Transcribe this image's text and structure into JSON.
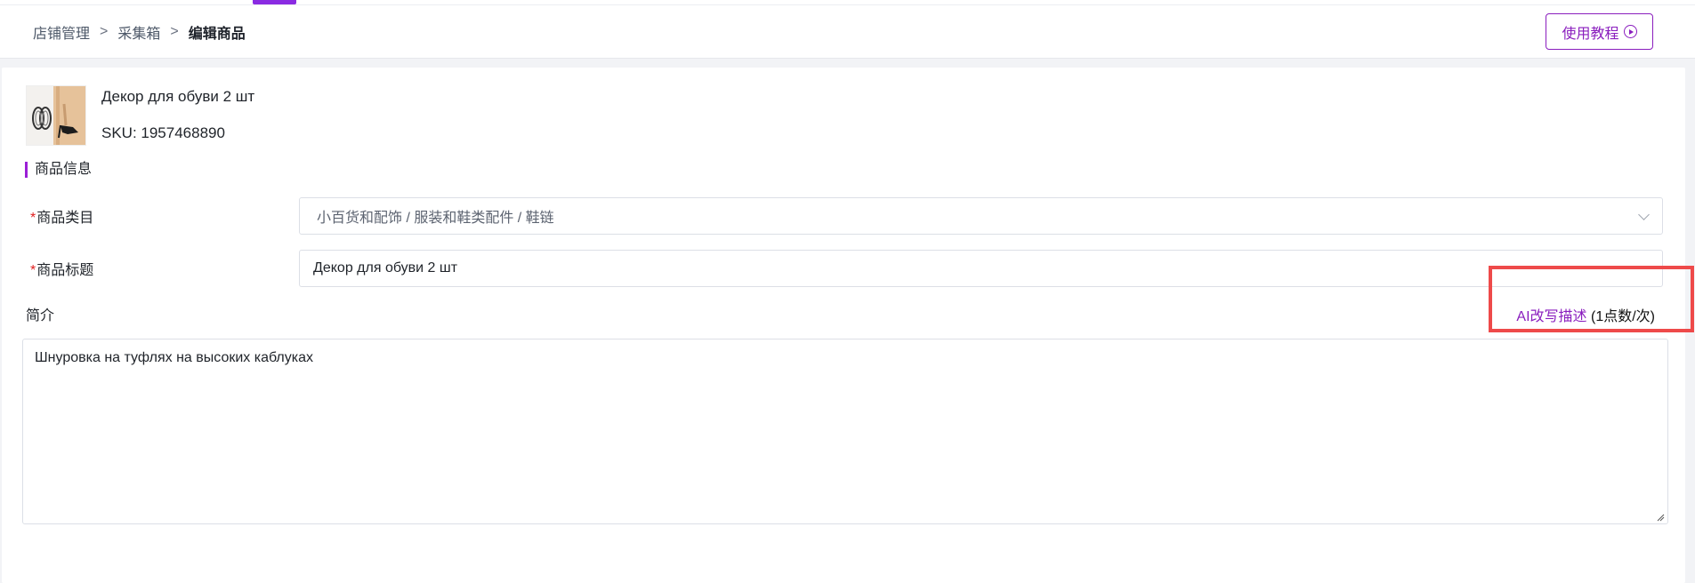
{
  "breadcrumb": {
    "items": [
      "店铺管理",
      "采集箱",
      "编辑商品"
    ],
    "separator": ">"
  },
  "header": {
    "tutorial_label": "使用教程"
  },
  "product": {
    "name": "Декор для обуви 2 шт",
    "sku": "SKU: 1957468890"
  },
  "section": {
    "title": "商品信息"
  },
  "fields": {
    "required_mark": "*",
    "category_label": "商品类目",
    "category_value": "小百货和配饰 / 服装和鞋类配件 / 鞋链",
    "title_label": "商品标题",
    "title_value": "Декор для обуви 2 шт",
    "intro_label": "简介",
    "intro_value": "Шнуровка на туфлях на высоких каблуках"
  },
  "ai": {
    "rewrite_label": "AI改写描述",
    "cost_label": "(1点数/次)"
  },
  "colors": {
    "accent": "#8a1ebe",
    "required": "#e02020",
    "highlight": "#ee4a4a"
  }
}
